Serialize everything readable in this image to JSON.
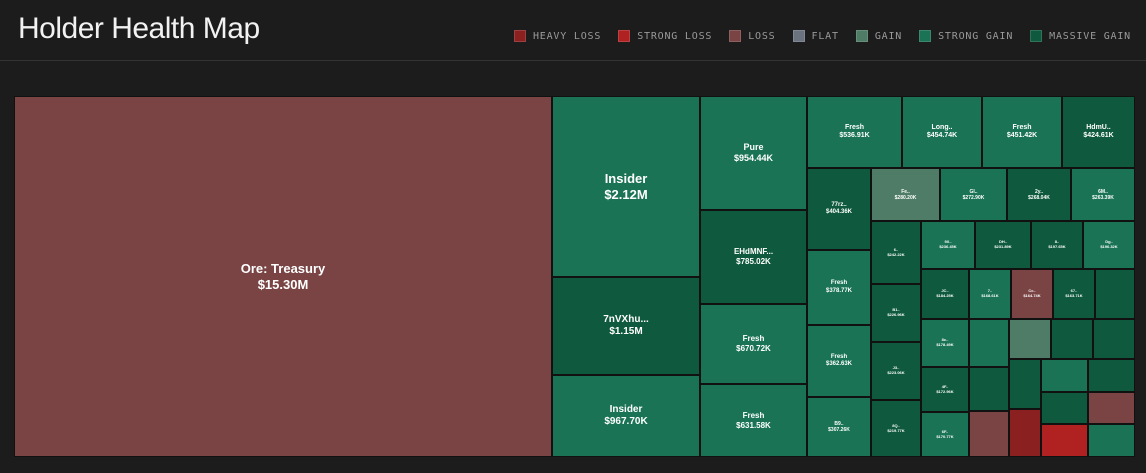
{
  "header": {
    "title": "Holder Health Map"
  },
  "legend": [
    {
      "label": "HEAVY LOSS",
      "color": "#8a2020"
    },
    {
      "label": "STRONG LOSS",
      "color": "#b02222"
    },
    {
      "label": "LOSS",
      "color": "#7a4444"
    },
    {
      "label": "FLAT",
      "color": "#6b7280"
    },
    {
      "label": "GAIN",
      "color": "#4e7c66"
    },
    {
      "label": "STRONG GAIN",
      "color": "#1a7355"
    },
    {
      "label": "MASSIVE GAIN",
      "color": "#0f5a3e"
    }
  ],
  "chart_data": {
    "type": "treemap",
    "title": "Holder Health Map",
    "tiles": [
      {
        "name": "Ore: Treasury",
        "value": "$15.30M",
        "category": "LOSS"
      },
      {
        "name": "Insider",
        "value": "$2.12M",
        "category": "STRONG GAIN"
      },
      {
        "name": "7nVXhu...",
        "value": "$1.15M",
        "category": "MASSIVE GAIN"
      },
      {
        "name": "Insider",
        "value": "$967.70K",
        "category": "STRONG GAIN"
      },
      {
        "name": "Pure",
        "value": "$954.44K",
        "category": "STRONG GAIN"
      },
      {
        "name": "EHdMNF...",
        "value": "$785.02K",
        "category": "MASSIVE GAIN"
      },
      {
        "name": "Fresh",
        "value": "$670.72K",
        "category": "STRONG GAIN"
      },
      {
        "name": "Fresh",
        "value": "$631.58K",
        "category": "STRONG GAIN"
      },
      {
        "name": "Fresh",
        "value": "$536.91K",
        "category": "STRONG GAIN"
      },
      {
        "name": "Long..",
        "value": "$454.74K",
        "category": "STRONG GAIN"
      },
      {
        "name": "Fresh",
        "value": "$451.42K",
        "category": "STRONG GAIN"
      },
      {
        "name": "HdmU..",
        "value": "$424.61K",
        "category": "MASSIVE GAIN"
      },
      {
        "name": "77rz..",
        "value": "$404.36K",
        "category": "MASSIVE GAIN"
      },
      {
        "name": "Fresh",
        "value": "$378.77K",
        "category": "STRONG GAIN"
      },
      {
        "name": "Fresh",
        "value": "$362.63K",
        "category": "STRONG GAIN"
      },
      {
        "name": "B9..",
        "value": "$307.26K",
        "category": "STRONG GAIN"
      },
      {
        "name": "Fe..",
        "value": "$280.20K",
        "category": "GAIN"
      },
      {
        "name": "GI..",
        "value": "$272.90K",
        "category": "STRONG GAIN"
      },
      {
        "name": "2y..",
        "value": "$268.04K",
        "category": "MASSIVE GAIN"
      },
      {
        "name": "6M..",
        "value": "$263.39K",
        "category": "STRONG GAIN"
      },
      {
        "name": "6..",
        "value": "$242.22K",
        "category": "MASSIVE GAIN"
      },
      {
        "name": "9X..",
        "value": "$236.45K",
        "category": "STRONG GAIN"
      },
      {
        "name": "DH..",
        "value": "$231.89K",
        "category": "MASSIVE GAIN"
      },
      {
        "name": "8..",
        "value": "$197.65K",
        "category": "MASSIVE GAIN"
      },
      {
        "name": "Dg..",
        "value": "$196.32K",
        "category": "STRONG GAIN"
      },
      {
        "name": "B1..",
        "value": "$226.96K",
        "category": "MASSIVE GAIN"
      },
      {
        "name": "JC..",
        "value": "$184.25K",
        "category": "MASSIVE GAIN"
      },
      {
        "name": "7..",
        "value": "$168.61K",
        "category": "STRONG GAIN"
      },
      {
        "name": "Cc..",
        "value": "$164.74K",
        "category": "LOSS"
      },
      {
        "name": "67..",
        "value": "$163.71K",
        "category": "MASSIVE GAIN"
      },
      {
        "name": "J3..",
        "value": "$223.06K",
        "category": "MASSIVE GAIN"
      },
      {
        "name": "8c..",
        "value": "$178.49K",
        "category": "STRONG GAIN"
      },
      {
        "name": "4F..",
        "value": "$172.96K",
        "category": "MASSIVE GAIN"
      },
      {
        "name": "8Q..",
        "value": "$219.77K",
        "category": "MASSIVE GAIN"
      },
      {
        "name": "6F..",
        "value": "$170.77K",
        "category": "STRONG GAIN"
      },
      {
        "name": "",
        "value": "",
        "category": "MASSIVE GAIN"
      },
      {
        "name": "",
        "value": "",
        "category": "STRONG GAIN"
      },
      {
        "name": "",
        "value": "",
        "category": "GAIN"
      },
      {
        "name": "",
        "value": "",
        "category": "MASSIVE GAIN"
      },
      {
        "name": "",
        "value": "",
        "category": "MASSIVE GAIN"
      },
      {
        "name": "",
        "value": "",
        "category": "MASSIVE GAIN"
      },
      {
        "name": "",
        "value": "",
        "category": "MASSIVE GAIN"
      },
      {
        "name": "",
        "value": "",
        "category": "STRONG GAIN"
      },
      {
        "name": "",
        "value": "",
        "category": "MASSIVE GAIN"
      },
      {
        "name": "",
        "value": "",
        "category": "MASSIVE GAIN"
      },
      {
        "name": "",
        "value": "",
        "category": "LOSS"
      },
      {
        "name": "",
        "value": "",
        "category": "LOSS"
      },
      {
        "name": "",
        "value": "",
        "category": "HEAVY LOSS"
      },
      {
        "name": "",
        "value": "",
        "category": "STRONG LOSS"
      },
      {
        "name": "",
        "value": "",
        "category": "STRONG GAIN"
      }
    ]
  }
}
